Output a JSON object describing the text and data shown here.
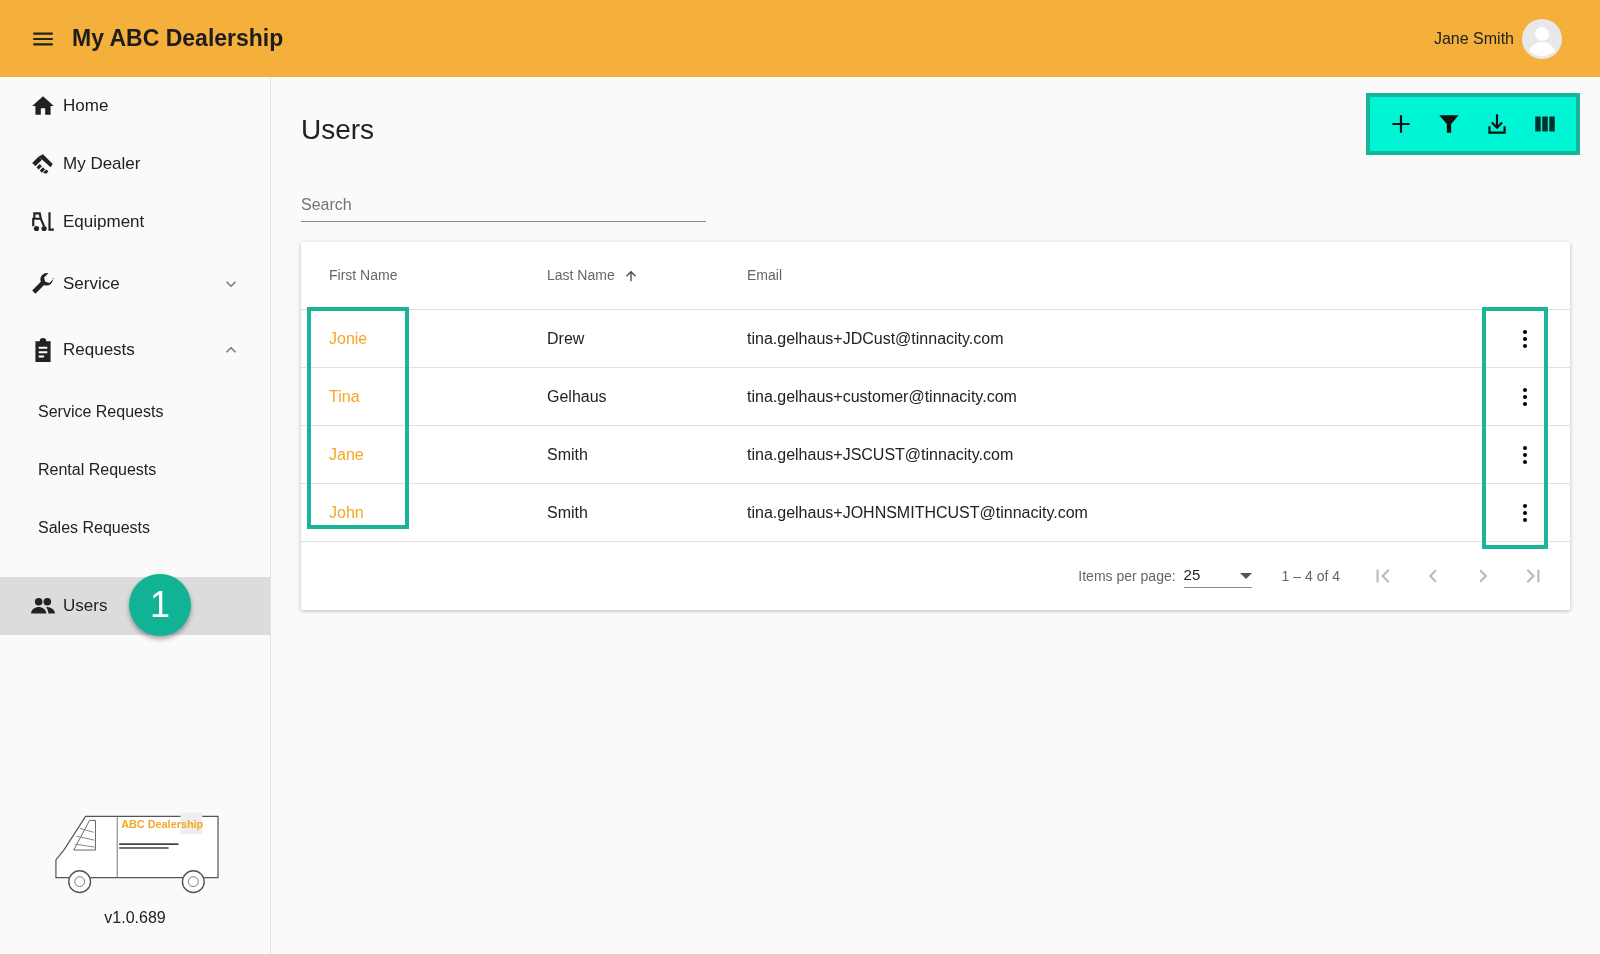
{
  "app": {
    "title": "My ABC Dealership",
    "user": "Jane Smith"
  },
  "sidebar": {
    "items": [
      {
        "label": "Home",
        "kind": "link",
        "selected": false
      },
      {
        "label": "My Dealer",
        "kind": "link",
        "selected": false
      },
      {
        "label": "Equipment",
        "kind": "link",
        "selected": false
      },
      {
        "label": "Service",
        "kind": "group",
        "selected": false,
        "expanded": false
      },
      {
        "label": "Requests",
        "kind": "group",
        "selected": false,
        "expanded": true,
        "children": [
          {
            "label": "Service Requests"
          },
          {
            "label": "Rental Requests"
          },
          {
            "label": "Sales Requests"
          }
        ]
      },
      {
        "label": "Users",
        "kind": "link",
        "selected": true,
        "badge": "1"
      }
    ],
    "logo": {
      "text": "ABC Dealership"
    },
    "version": "v1.0.689"
  },
  "page": {
    "title": "Users",
    "search": {
      "placeholder": "Search"
    },
    "toolbar_highlighted": true
  },
  "table": {
    "columns": [
      {
        "label": "First Name",
        "sorted": false
      },
      {
        "label": "Last Name",
        "sorted": true
      },
      {
        "label": "Email",
        "sorted": false
      }
    ],
    "rows": [
      {
        "first": "Jonie",
        "last": "Drew",
        "email": "tina.gelhaus+JDCust@tinnacity.com"
      },
      {
        "first": "Tina",
        "last": "Gelhaus",
        "email": "tina.gelhaus+customer@tinnacity.com"
      },
      {
        "first": "Jane",
        "last": "Smith",
        "email": "tina.gelhaus+JSCUST@tinnacity.com"
      },
      {
        "first": "John",
        "last": "Smith",
        "email": "tina.gelhaus+JOHNSMITHCUST@tinnacity.com"
      }
    ],
    "first_names_highlighted": true,
    "row_menus_highlighted": true,
    "pagination": {
      "label": "Items per page:",
      "page_size": "25",
      "range": "1 – 4 of 4",
      "buttons": [
        {
          "disabled": true
        },
        {
          "disabled": true
        },
        {
          "disabled": true
        },
        {
          "disabled": true
        }
      ]
    }
  }
}
